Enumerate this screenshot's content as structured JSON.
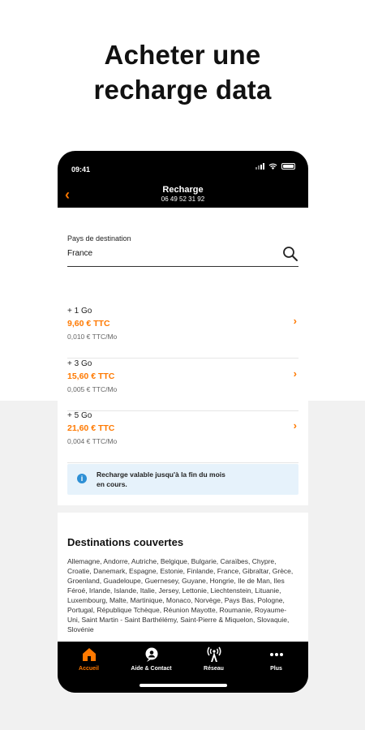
{
  "headline": {
    "line1": "Acheter une",
    "line2": "recharge data"
  },
  "status_bar": {
    "time": "09:41"
  },
  "nav": {
    "title": "Recharge",
    "subtitle": "06 49 52 31 92"
  },
  "search": {
    "label": "Pays de destination",
    "value": "France"
  },
  "offers": [
    {
      "data": "+ 1 Go",
      "price": "9,60 € TTC",
      "unit": "0,010 € TTC/Mo"
    },
    {
      "data": "+ 3 Go",
      "price": "15,60 € TTC",
      "unit": "0,005 € TTC/Mo"
    },
    {
      "data": "+ 5 Go",
      "price": "21,60 € TTC",
      "unit": "0,004 € TTC/Mo"
    }
  ],
  "info": {
    "line1": "Recharge valable jusqu'à la fin du mois",
    "line2": "en cours."
  },
  "destinations": {
    "title": "Destinations couvertes",
    "text": "Allemagne, Andorre, Autriche, Belgique, Bulgarie, Caraïbes, Chypre, Croatie, Danemark, Espagne, Estonie, Finlande, France, Gibraltar, Grèce, Groenland, Guadeloupe, Guernesey, Guyane, Hongrie, Ile de Man, Iles Féroé, Irlande, Islande, Italie, Jersey, Lettonie, Liechtenstein, Lituanie, Luxembourg, Malte, Martinique, Monaco, Norvège, Pays Bas, Pologne, Portugal, République Tchèque, Réunion Mayotte, Roumanie, Royaume-Uni, Saint Martin - Saint Barthélémy, Saint-Pierre & Miquelon, Slovaquie, Slovénie"
  },
  "tabs": [
    {
      "label": "Accueil",
      "icon": "home-icon",
      "active": true
    },
    {
      "label": "Aide & Contact",
      "icon": "help-contact-icon",
      "active": false
    },
    {
      "label": "Réseau",
      "icon": "network-antenna-icon",
      "active": false
    },
    {
      "label": "Plus",
      "icon": "more-dots-icon",
      "active": false
    }
  ],
  "colors": {
    "accent": "#ff7900",
    "info_bg": "#e6f2fb",
    "info_icon": "#2d8fd5"
  }
}
